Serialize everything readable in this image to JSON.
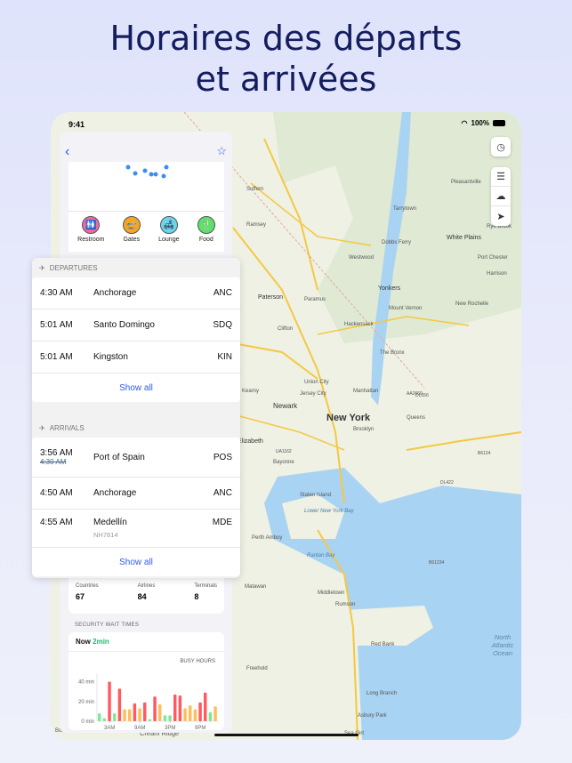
{
  "headline": {
    "line1": "Horaires des départs",
    "line2": "et arrivées"
  },
  "status": {
    "time": "9:41",
    "battery": "100%"
  },
  "map": {
    "labels": [
      "New York",
      "Newark",
      "Yonkers",
      "White Plains",
      "Paterson",
      "Hackensack",
      "Elizabeth",
      "Perth Amboy",
      "Staten Island",
      "Lower New York Bay",
      "Raritan Bay",
      "Middletown",
      "Freehold",
      "Red Bank",
      "Long Branch",
      "Asbury Park",
      "Sea Girt",
      "North Atlantic Ocean",
      "Pleasantville",
      "New Rochelle",
      "Clifton",
      "Kearny",
      "Bayonne",
      "Jersey City",
      "Queens",
      "Brooklyn",
      "The Bronx",
      "Manhattan",
      "Tarrytown",
      "Suffern",
      "Ramsey",
      "Dobbs Ferry",
      "Port Chester",
      "Rye Brook",
      "Harrison",
      "Mount Vernon",
      "Matawan",
      "Rumson",
      "Bordentown",
      "Cream Ridge",
      "Union City",
      "Westwood",
      "Paramus"
    ],
    "flights": [
      "AA2660",
      "DL556",
      "UA1162",
      "B6124",
      "DL422",
      "B61234"
    ]
  },
  "map_controls": [
    "clock-icon",
    "filter-icon",
    "weather-icon",
    "location-arrow-icon"
  ],
  "sidebar": {
    "amenities": [
      {
        "label": "Restroom",
        "color": "#f06aa0",
        "icon": "🚻"
      },
      {
        "label": "Gates",
        "color": "#f5a623",
        "icon": "🛫"
      },
      {
        "label": "Lounge",
        "color": "#6fd3f0",
        "icon": "🛋"
      },
      {
        "label": "Food",
        "color": "#5fe06a",
        "icon": "🍴"
      }
    ],
    "stats": [
      {
        "label": "Countries",
        "value": "67"
      },
      {
        "label": "Airlines",
        "value": "84"
      },
      {
        "label": "Terminals",
        "value": "8"
      }
    ],
    "security": {
      "title": "SECURITY WAIT TIMES",
      "now_label": "Now",
      "now_value": "2min",
      "busy_label": "BUSY HOURS"
    }
  },
  "departures": {
    "title": "DEPARTURES",
    "rows": [
      {
        "time": "4:30 AM",
        "city": "Anchorage",
        "code": "ANC"
      },
      {
        "time": "5:01 AM",
        "city": "Santo Domingo",
        "code": "SDQ"
      },
      {
        "time": "5:01 AM",
        "city": "Kingston",
        "code": "KIN"
      }
    ],
    "show_all": "Show all"
  },
  "arrivals": {
    "title": "ARRIVALS",
    "rows": [
      {
        "time": "3:56 AM",
        "old_time": "4:30 AM",
        "city": "Port of Spain",
        "code": "POS"
      },
      {
        "time": "4:50 AM",
        "city": "Anchorage",
        "code": "ANC"
      },
      {
        "time": "4:55 AM",
        "city": "Medellín",
        "code": "MDE",
        "flight": "NH7814"
      }
    ],
    "show_all": "Show all"
  },
  "chart_data": {
    "type": "bar",
    "ylabel": "",
    "yticks": [
      "0 min",
      "20 min",
      "40 min"
    ],
    "ylim": [
      0,
      45
    ],
    "xticks": [
      "3AM",
      "9AM",
      "3PM",
      "9PM"
    ],
    "values": [
      8,
      3,
      40,
      8,
      33,
      12,
      12,
      18,
      13,
      19,
      2,
      25,
      17,
      6,
      6,
      27,
      26,
      13,
      16,
      12,
      19,
      29,
      9,
      15
    ],
    "colors": {
      "low": "#7ee89a",
      "mid": "#ffbd5c",
      "high": "#ff5a5f"
    }
  }
}
